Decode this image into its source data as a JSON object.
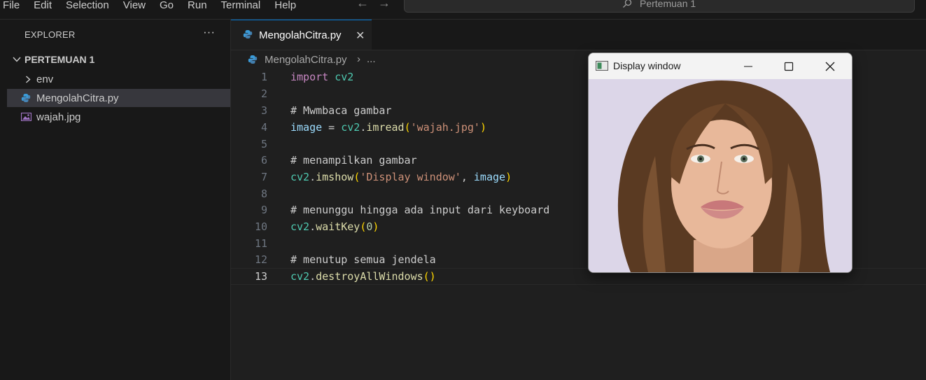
{
  "menu": [
    "File",
    "Edit",
    "Selection",
    "View",
    "Go",
    "Run",
    "Terminal",
    "Help"
  ],
  "command_center": {
    "label": "Pertemuan 1"
  },
  "sidebar": {
    "header": "EXPLORER",
    "more": "···",
    "folder": "PERTEMUAN 1",
    "items": [
      {
        "label": "env",
        "icon": "chevron-right-icon"
      },
      {
        "label": "MengolahCitra.py",
        "icon": "python-file-icon"
      },
      {
        "label": "wajah.jpg",
        "icon": "image-file-icon"
      }
    ]
  },
  "tab": {
    "label": "MengolahCitra.py",
    "close": "✕"
  },
  "breadcrumb": {
    "file": "MengolahCitra.py",
    "sep": "›",
    "more": "..."
  },
  "code": {
    "line_numbers": [
      "1",
      "2",
      "3",
      "4",
      "5",
      "6",
      "7",
      "8",
      "9",
      "10",
      "11",
      "12",
      "13"
    ],
    "l1": {
      "kw": "import",
      "mod": "cv2"
    },
    "l3": "# Mwmbaca gambar",
    "l4": {
      "var": "image",
      "eq": " = ",
      "mod": "cv2",
      "dot": ".",
      "fn": "imread",
      "po": "(",
      "str": "'wajah.jpg'",
      "pc": ")"
    },
    "l6": "# menampilkan gambar",
    "l7": {
      "mod": "cv2",
      "dot": ".",
      "fn": "imshow",
      "po": "(",
      "str": "'Display window'",
      "comma": ", ",
      "var": "image",
      "pc": ")"
    },
    "l9": "# menunggu hingga ada input dari keyboard",
    "l10": {
      "mod": "cv2",
      "dot": ".",
      "fn": "waitKey",
      "po": "(",
      "num": "0",
      "pc": ")"
    },
    "l12": "# menutup semua jendela",
    "l13": {
      "mod": "cv2",
      "dot": ".",
      "fn": "destroyAllWindows",
      "paren": "()"
    }
  },
  "display_window": {
    "title": "Display window"
  },
  "colors": {
    "accent": "#0078d4",
    "editor_bg": "#1f1f1f",
    "sidebar_bg": "#181818"
  }
}
